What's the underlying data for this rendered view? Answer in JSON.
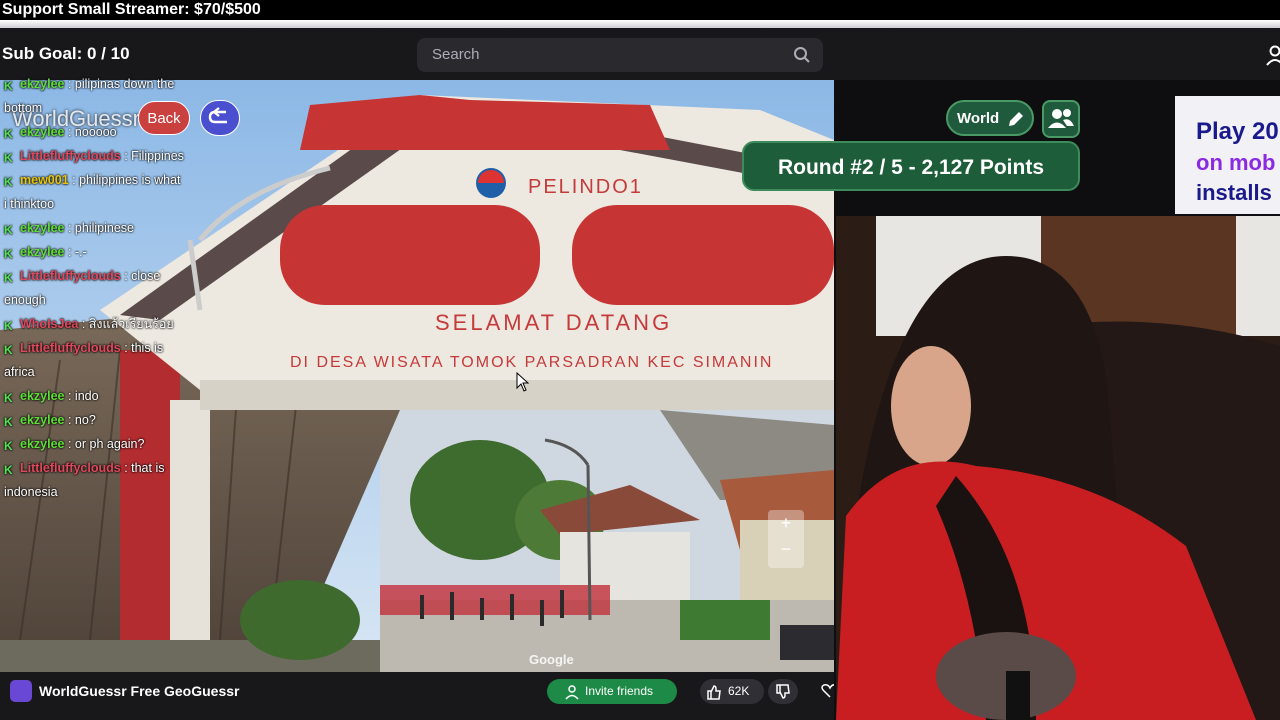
{
  "banner": {
    "text": "Support Small Streamer: $70/$500"
  },
  "header": {
    "sub_goal": "Sub Goal:  0 / 10",
    "search_placeholder": "Search"
  },
  "game": {
    "title": "WorldGuessr",
    "back_label": "Back",
    "map_button": "World",
    "round_text": "Round #2 / 5 - 2,127 Points",
    "zoom_in": "+",
    "zoom_out": "−",
    "imagery_credit": "Google",
    "sign_brand": "PELINDO1",
    "sign_line1": "SELAMAT  DATANG",
    "sign_line2": "DI DESA WISATA TOMOK PARSADRAN KEC SIMANIN"
  },
  "promo": {
    "line1": "Play 20",
    "line2": "on mob",
    "line3": "installs"
  },
  "chat": [
    {
      "user": "ekzylee",
      "color": "#5fdc3a",
      "msg": ": pilipinas down the",
      "wrap": "bottom"
    },
    {
      "user": "ekzylee",
      "color": "#5fdc3a",
      "msg": ": nooooo"
    },
    {
      "user": "Littlefluffyclouds",
      "color": "#e0485d",
      "msg": ": Filippines"
    },
    {
      "user": "mew001",
      "color": "#e5c60e",
      "msg": ": philippines is what",
      "wrap": "i thinktoo"
    },
    {
      "user": "ekzylee",
      "color": "#5fdc3a",
      "msg": ": philipinese"
    },
    {
      "user": "ekzylee",
      "color": "#5fdc3a",
      "msg": ": -.-"
    },
    {
      "user": "Littlefluffyclouds",
      "color": "#e0485d",
      "msg": ": close",
      "wrap": "enough"
    },
    {
      "user": "WhoIsJea",
      "color": "#e0485d",
      "msg": ": สิงแล้วเรียนร้อย"
    },
    {
      "user": "Littlefluffyclouds",
      "color": "#e0485d",
      "msg": ": this is",
      "wrap": "africa"
    },
    {
      "user": "ekzylee",
      "color": "#5fdc3a",
      "msg": ": indo"
    },
    {
      "user": "ekzylee",
      "color": "#5fdc3a",
      "msg": ": no?"
    },
    {
      "user": "ekzylee",
      "color": "#5fdc3a",
      "msg": ": or ph again?"
    },
    {
      "user": "Littlefluffyclouds",
      "color": "#e0485d",
      "msg": ": that is",
      "wrap": "indonesia"
    }
  ],
  "bottom": {
    "channel_name": "WorldGuessr Free GeoGuessr",
    "invite_label": "Invite friends",
    "like_count": "62K"
  },
  "colors": {
    "accent_green": "#1e5d3a",
    "back_red": "#c9403f",
    "undo_purple": "#4a4fcf"
  },
  "icons": [
    "search-icon",
    "user-icon",
    "undo-arrow-icon",
    "pencil-icon",
    "players-icon",
    "thumbs-up-icon",
    "thumbs-down-icon",
    "heart-icon",
    "invite-icon"
  ]
}
